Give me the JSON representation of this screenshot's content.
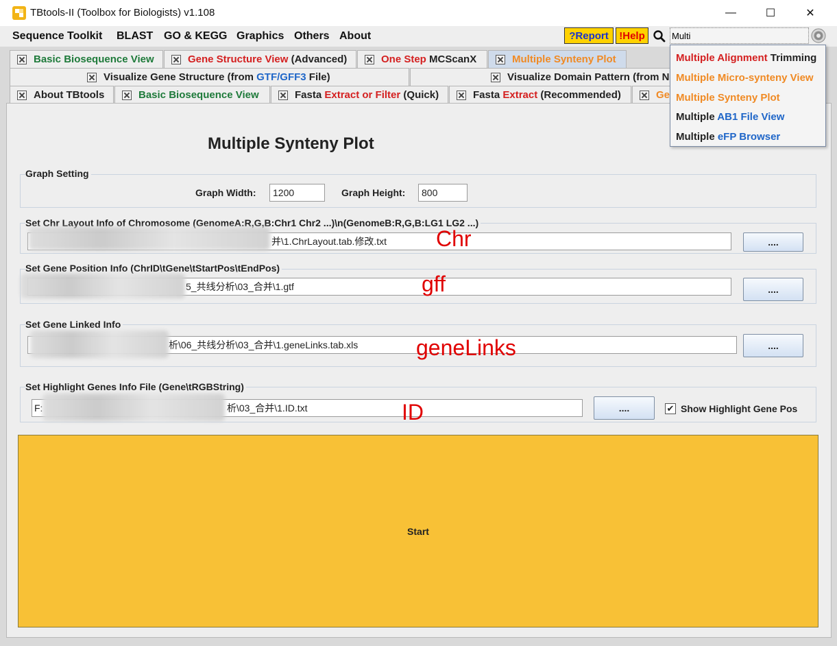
{
  "window": {
    "title": "TBtools-II (Toolbox for Biologists) v1.108",
    "minimize_glyph": "—",
    "maximize_glyph": "☐",
    "close_glyph": "✕"
  },
  "menu": {
    "items": [
      "Sequence Toolkit",
      "BLAST",
      "GO & KEGG",
      "Graphics",
      "Others",
      "About"
    ],
    "report_label": "?Report",
    "help_label": "!Help",
    "search_value": "Multi",
    "search_icon": "search-icon",
    "settings_icon": "settings-icon"
  },
  "tabs": {
    "row1": [
      {
        "parts": [
          {
            "t": "Basic Biosequence View",
            "c": "green"
          }
        ]
      },
      {
        "parts": [
          {
            "t": "Gene Structure View ",
            "c": "red"
          },
          {
            "t": "(Advanced)",
            "c": "dark"
          }
        ]
      },
      {
        "parts": [
          {
            "t": "One Step ",
            "c": "red"
          },
          {
            "t": "MCScanX",
            "c": "dark"
          }
        ]
      },
      {
        "parts": [
          {
            "t": "Multiple Synteny Plot",
            "c": "orange"
          }
        ],
        "active": true
      }
    ],
    "row2": [
      {
        "parts": [
          {
            "t": "Visualize Gene Structure (from ",
            "c": "dark"
          },
          {
            "t": "GTF/GFF3",
            "c": "blue"
          },
          {
            "t": " File)",
            "c": "dark"
          }
        ]
      },
      {
        "parts": [
          {
            "t": "Visualize Domain Pattern (from NC",
            "c": "dark"
          }
        ]
      }
    ],
    "row3": [
      {
        "parts": [
          {
            "t": "About TBtools",
            "c": "dark"
          }
        ]
      },
      {
        "parts": [
          {
            "t": "Basic Biosequence View",
            "c": "green"
          }
        ]
      },
      {
        "parts": [
          {
            "t": "Fasta ",
            "c": "dark"
          },
          {
            "t": "Extract or Filter",
            "c": "red"
          },
          {
            "t": " (Quick)",
            "c": "dark"
          }
        ]
      },
      {
        "parts": [
          {
            "t": "Fasta ",
            "c": "dark"
          },
          {
            "t": "Extract",
            "c": "red"
          },
          {
            "t": " (Recommended)",
            "c": "dark"
          }
        ]
      },
      {
        "parts": [
          {
            "t": "Ge",
            "c": "orange"
          }
        ]
      }
    ]
  },
  "form": {
    "title": "Multiple Synteny Plot",
    "graph_setting": {
      "label": "Graph Setting",
      "width_label": "Graph Width:",
      "width_value": "1200",
      "height_label": "Graph Height:",
      "height_value": "800"
    },
    "chr_layout": {
      "label": "Set Chr Layout Info of Chromosome (GenomeA:R,G,B:Chr1 Chr2 ...)\\n(GenomeB:R,G,B:LG1 LG2 ...)",
      "value": "并\\1.ChrLayout.tab.修改.txt",
      "browse_label": "....",
      "annotation": "Chr"
    },
    "gene_position": {
      "label": "Set Gene Position Info (ChrID\\tGene\\tStartPos\\tEndPos)",
      "value": "5_共线分析\\03_合并\\1.gtf",
      "browse_label": "....",
      "annotation": "gff"
    },
    "gene_linked": {
      "label": "Set Gene Linked Info",
      "value": "析\\06_共线分析\\03_合并\\1.geneLinks.tab.xls",
      "browse_label": "....",
      "annotation": "geneLinks"
    },
    "highlight": {
      "label": "Set Highlight Genes Info File (Gene\\tRGBString)",
      "value_prefix": "F:",
      "value": "析\\03_合并\\1.ID.txt",
      "browse_label": "....",
      "annotation": "ID",
      "checkbox_label": "Show Highlight Gene Pos",
      "checkbox_mark": "✔"
    },
    "start_label": "Start"
  },
  "dropdown": {
    "items": [
      {
        "parts": [
          {
            "t": "Multiple ",
            "c": "red"
          },
          {
            "t": "Alignment ",
            "c": "red"
          },
          {
            "t": "Trimming",
            "c": "dark"
          }
        ]
      },
      {
        "parts": [
          {
            "t": "Multiple Micro-synteny View",
            "c": "orange"
          }
        ]
      },
      {
        "parts": [
          {
            "t": "Multiple Synteny Plot",
            "c": "orange"
          }
        ]
      },
      {
        "parts": [
          {
            "t": "Multiple ",
            "c": "dark"
          },
          {
            "t": "AB1 File View",
            "c": "blue"
          }
        ]
      },
      {
        "parts": [
          {
            "t": "Multiple ",
            "c": "dark"
          },
          {
            "t": "eFP Browser",
            "c": "blue"
          }
        ]
      }
    ]
  },
  "colors": {
    "accent_yellow": "#f8c136",
    "button_yellow": "#ffd200",
    "annotation_red": "#e00000",
    "active_tab": "#cfdbeb"
  }
}
